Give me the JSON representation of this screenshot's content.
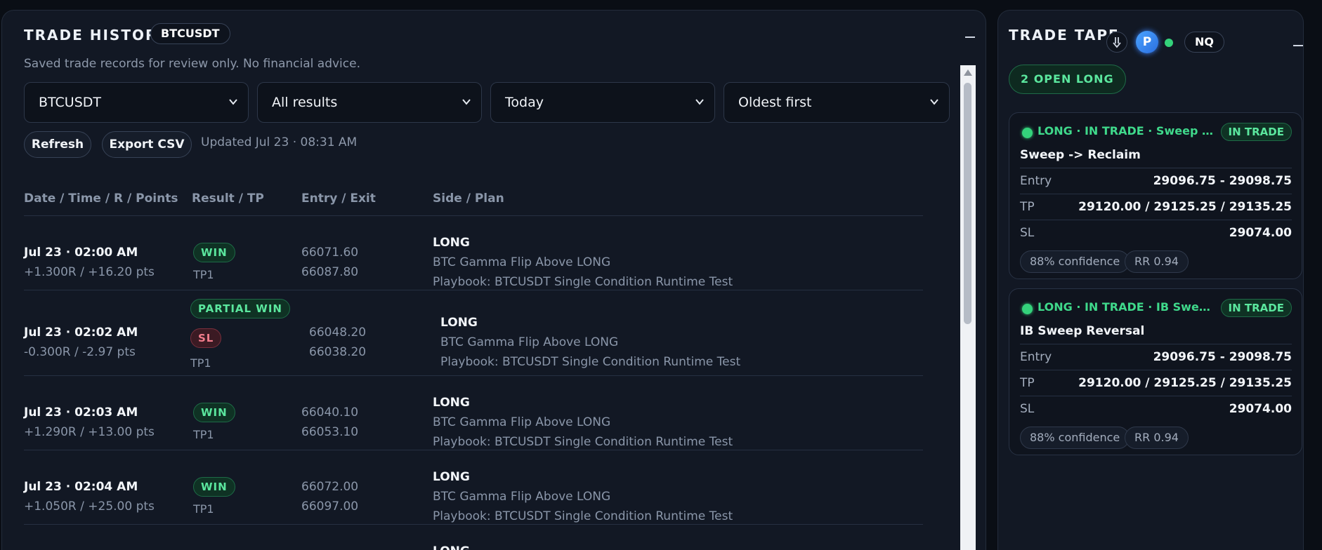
{
  "history": {
    "title": "TRADE HISTORY",
    "symbol_chip": "BTCUSDT",
    "subtitle": "Saved trade records for review only. No financial advice.",
    "filters": {
      "symbol": "BTCUSDT",
      "result": "All results",
      "range": "Today",
      "sort": "Oldest first"
    },
    "refresh_label": "Refresh",
    "export_label": "Export CSV",
    "updated": "Updated Jul 23 · 08:31 AM",
    "columns": [
      "Date / Time / R / Points",
      "Result / TP",
      "Entry / Exit",
      "Side / Plan"
    ],
    "rows": [
      {
        "datetime": "Jul 23 · 02:00 AM",
        "r_points": "+1.300R / +16.20 pts",
        "result": "WIN",
        "tp": "TP1",
        "entry": "66071.60",
        "exit": "66087.80",
        "side": "LONG",
        "signal": "BTC Gamma Flip Above LONG",
        "playbook": "Playbook: BTCUSDT Single Condition Runtime Test"
      },
      {
        "datetime": "Jul 23 · 02:02 AM",
        "r_points": "-0.300R / -2.97 pts",
        "result": "PARTIAL WIN",
        "result2": "SL",
        "tp": "TP1",
        "entry": "66048.20",
        "exit": "66038.20",
        "side": "LONG",
        "signal": "BTC Gamma Flip Above LONG",
        "playbook": "Playbook: BTCUSDT Single Condition Runtime Test"
      },
      {
        "datetime": "Jul 23 · 02:03 AM",
        "r_points": "+1.290R / +13.00 pts",
        "result": "WIN",
        "tp": "TP1",
        "entry": "66040.10",
        "exit": "66053.10",
        "side": "LONG",
        "signal": "BTC Gamma Flip Above LONG",
        "playbook": "Playbook: BTCUSDT Single Condition Runtime Test"
      },
      {
        "datetime": "Jul 23 · 02:04 AM",
        "r_points": "+1.050R / +25.00 pts",
        "result": "WIN",
        "tp": "TP1",
        "entry": "66072.00",
        "exit": "66097.00",
        "side": "LONG",
        "signal": "BTC Gamma Flip Above LONG",
        "playbook": "Playbook: BTCUSDT Single Condition Runtime Test"
      },
      {
        "side": "LONG"
      }
    ]
  },
  "tape": {
    "title": "TRADE TAPE",
    "avatar_letter": "P",
    "symbol_chip": "NQ",
    "open_summary": "2 OPEN LONG",
    "cards": [
      {
        "headline": "LONG · IN TRADE · Sweep Star...",
        "badge": "IN TRADE",
        "title": "Sweep -> Reclaim",
        "entry_label": "Entry",
        "entry": "29096.75 - 29098.75",
        "tp_label": "TP",
        "tp": "29120.00 / 29125.25 / 29135.25",
        "sl_label": "SL",
        "sl": "29074.00",
        "confidence": "88% confidence",
        "rr": "RR 0.94"
      },
      {
        "headline": "LONG · IN TRADE · IB Sweep &...",
        "badge": "IN TRADE",
        "title": "IB Sweep Reversal",
        "entry_label": "Entry",
        "entry": "29096.75 - 29098.75",
        "tp_label": "TP",
        "tp": "29120.00 / 29125.25 / 29135.25",
        "sl_label": "SL",
        "sl": "29074.00",
        "confidence": "88% confidence",
        "rr": "RR 0.94"
      }
    ]
  },
  "colors": {
    "win": "#5be79e",
    "loss": "#f27d8c",
    "panel": "#121824",
    "accent_blue": "#3b82f6"
  },
  "icons": [
    "chevron-down-icon",
    "minimize-icon",
    "download-arrow-icon",
    "live-status-dot"
  ]
}
